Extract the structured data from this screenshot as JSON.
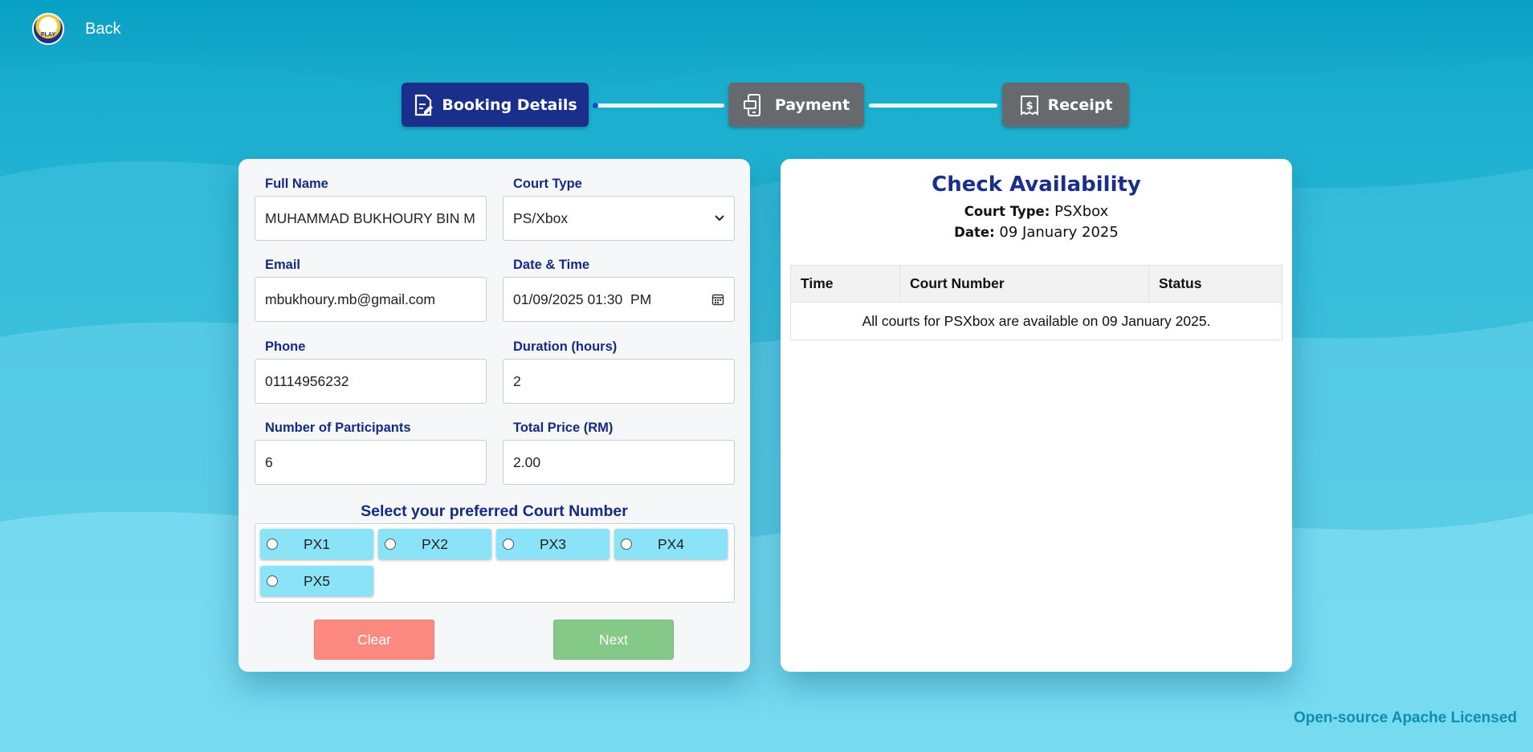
{
  "nav": {
    "back_label": "Back",
    "logo_icon": "mascot-logo-icon"
  },
  "stepper": {
    "steps": [
      {
        "label": "Booking Details",
        "icon": "edit-document-icon",
        "active": true
      },
      {
        "label": "Payment",
        "icon": "mobile-payment-icon",
        "active": false
      },
      {
        "label": "Receipt",
        "icon": "receipt-dollar-icon",
        "active": false
      }
    ]
  },
  "form": {
    "full_name": {
      "label": "Full Name",
      "value": "MUHAMMAD BUKHOURY BIN M"
    },
    "court_type": {
      "label": "Court Type",
      "value": "PS/Xbox"
    },
    "email": {
      "label": "Email",
      "value": "mbukhoury.mb@gmail.com"
    },
    "datetime": {
      "label": "Date & Time",
      "value": "01/09/2025 01:30  PM"
    },
    "phone": {
      "label": "Phone",
      "value": "01114956232"
    },
    "duration": {
      "label": "Duration (hours)",
      "value": "2"
    },
    "participants": {
      "label": "Number of Participants",
      "value": "6"
    },
    "total_price": {
      "label": "Total Price (RM)",
      "value": "2.00"
    },
    "court_select_title": "Select your preferred Court Number",
    "courts": [
      "PX1",
      "PX2",
      "PX3",
      "PX4",
      "PX5"
    ],
    "clear_label": "Clear",
    "next_label": "Next"
  },
  "availability": {
    "title": "Check Availability",
    "court_type_label": "Court Type:",
    "court_type_value": "PSXbox",
    "date_label": "Date:",
    "date_value": "09 January 2025",
    "columns": [
      "Time",
      "Court Number",
      "Status"
    ],
    "message": "All courts for PSXbox are available on 09 January 2025."
  },
  "footer": "Open-source Apache Licensed",
  "colors": {
    "accent": "#1a2f8c",
    "step_inactive": "#666a6e",
    "clear_button": "#fd8a80",
    "next_button": "#84c987",
    "court_option": "#8be3f7",
    "footer_text": "#0e8fb0"
  }
}
